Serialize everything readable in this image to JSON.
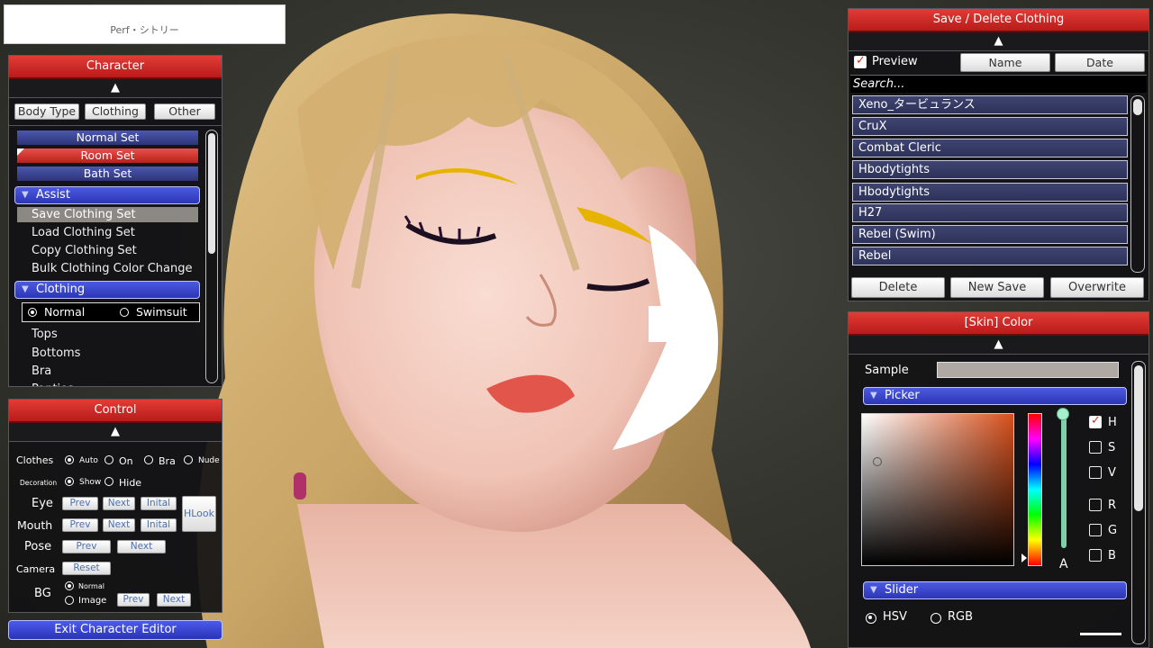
{
  "top_label": "Perf・シトリー",
  "character": {
    "title": "Character",
    "collapse": "▲",
    "tabs": [
      "Body Type",
      "Clothing",
      "Other"
    ],
    "sets": [
      "Normal Set",
      "Room Set",
      "Bath Set"
    ],
    "assist": {
      "label": "Assist",
      "items": [
        "Save Clothing Set",
        "Load Clothing Set",
        "Copy Clothing Set",
        "Bulk Clothing Color Change"
      ]
    },
    "clothing": {
      "label": "Clothing",
      "options": [
        "Normal",
        "Swimsuit"
      ],
      "items": [
        "Tops",
        "Bottoms",
        "Bra",
        "Panties"
      ]
    }
  },
  "control": {
    "title": "Control",
    "collapse": "▲",
    "clothes_label": "Clothes",
    "clothes_options": [
      "Auto",
      "On",
      "Bra",
      "Nude"
    ],
    "decoration_label": "Decoration",
    "decoration_options": [
      "Show",
      "Hide"
    ],
    "eye_label": "Eye",
    "mouth_label": "Mouth",
    "pose_label": "Pose",
    "camera_label": "Camera",
    "bg_label": "BG",
    "bg_options": [
      "Normal",
      "Image"
    ],
    "prev": "Prev",
    "next": "Next",
    "inital": "Inital",
    "reset": "Reset",
    "hlook": "HLook",
    "exit": "Exit Character Editor"
  },
  "save_panel": {
    "title": "Save / Delete Clothing",
    "collapse": "▲",
    "preview_label": "Preview",
    "sort_name": "Name",
    "sort_date": "Date",
    "search_placeholder": "Search...",
    "items": [
      "Xeno_タービュランス",
      "CruX",
      "Combat Cleric",
      "Hbodytights",
      "Hbodytights",
      "H27",
      "Rebel (Swim)",
      "Rebel"
    ],
    "delete": "Delete",
    "new_save": "New Save",
    "overwrite": "Overwrite"
  },
  "color_panel": {
    "title": "[Skin] Color",
    "collapse": "▲",
    "sample_label": "Sample",
    "sample_color": "#b0a8a3",
    "picker_label": "Picker",
    "channels": [
      "H",
      "S",
      "V",
      "R",
      "G",
      "B"
    ],
    "alpha_label": "A",
    "slider_label": "Slider",
    "modes": [
      "HSV",
      "RGB"
    ],
    "hue_color": "#d8501c"
  }
}
